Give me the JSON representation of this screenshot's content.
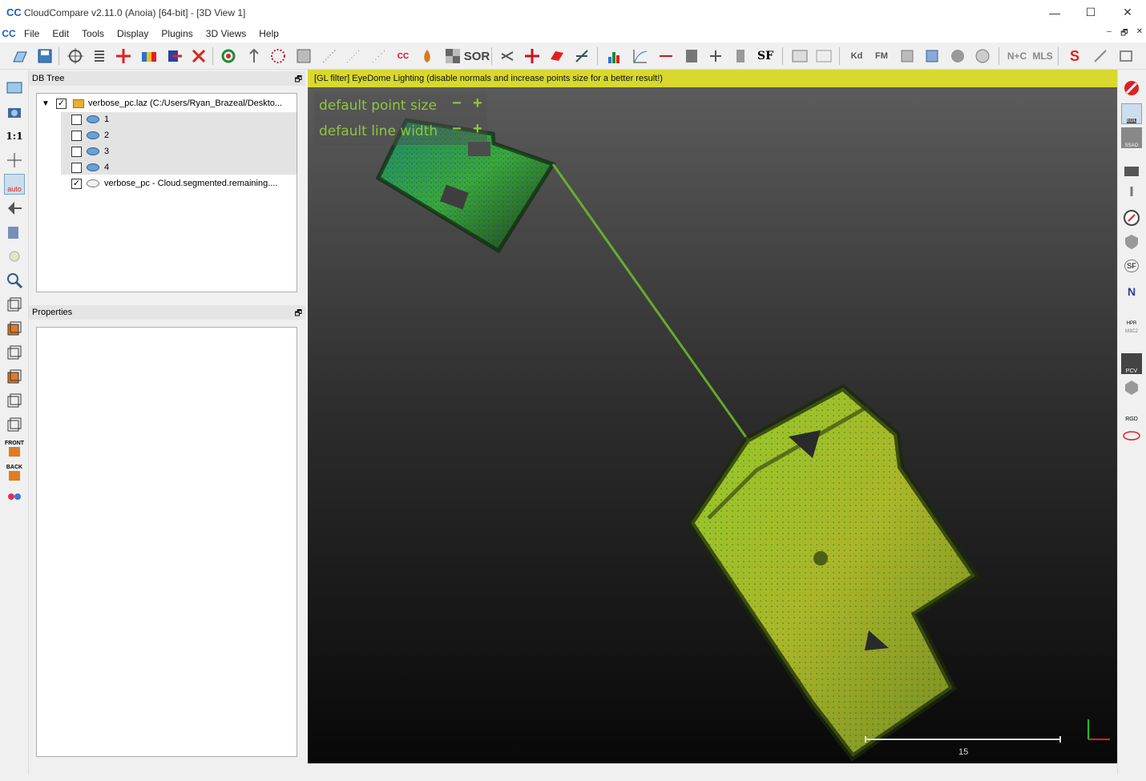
{
  "window": {
    "title": "CloudCompare v2.11.0 (Anoia) [64-bit] - [3D View 1]",
    "app_icon": "CC"
  },
  "window_controls": {
    "minimize": "—",
    "maximize": "☐",
    "close": "✕",
    "mdi_minimize": "–",
    "mdi_restore": "🗗",
    "mdi_close": "✕"
  },
  "menu": {
    "items": [
      "File",
      "Edit",
      "Tools",
      "Display",
      "Plugins",
      "3D Views",
      "Help"
    ]
  },
  "toolbar": {
    "icons": [
      "open-icon",
      "save-icon",
      "global-shift-icon",
      "list-icon",
      "add-point-icon",
      "color-ramp-icon",
      "sample-icon",
      "delete-icon",
      "register-icon",
      "pick-icon",
      "dots-icon",
      "mesh-icon",
      "subsample-icon",
      "scatter-icon",
      "project-icon",
      "cc-icon",
      "fire-icon",
      "checker-icon",
      "sor-icon",
      "scissors-icon",
      "translate-icon",
      "plane-icon",
      "axis-icon",
      "histogram-icon",
      "curve-icon",
      "minmax-icon",
      "calculator-icon",
      "plus-icon",
      "column-icon",
      "sf-icon",
      "canupo-create-icon",
      "canupo-classify-icon",
      "kd-icon",
      "fm-icon",
      "pdf-icon",
      "csv-icon",
      "sphere-icon",
      "globe-icon",
      "n-c-icon",
      "mls-icon",
      "s-icon",
      "tools-icon",
      "export-icon"
    ],
    "labels": {
      "cc": "CC",
      "sor": "SOR",
      "sf": "SF",
      "kd": "Kd",
      "fm": "FM",
      "n_c": "N+C",
      "mls": "MLS"
    }
  },
  "left_toolbar": {
    "ratio_label": "1:1",
    "auto_label": "auto",
    "front_label": "FRONT",
    "back_label": "BACK"
  },
  "right_toolbar": {
    "edl_label": "EDL",
    "ssao_label": "SSAO",
    "sf_label": "SF",
    "n_label": "N",
    "hpr_label": "HPR",
    "m3c2_label": "M3C2",
    "pcv_label": "PCV",
    "rgd_label": "RGD"
  },
  "db_tree": {
    "header": "DB Tree",
    "root": {
      "label": "verbose_pc.laz (C:/Users/Ryan_Brazeal/Deskto...",
      "checked": true
    },
    "children": [
      {
        "label": "1",
        "checked": false
      },
      {
        "label": "2",
        "checked": false
      },
      {
        "label": "3",
        "checked": false
      },
      {
        "label": "4",
        "checked": false
      },
      {
        "label": "verbose_pc - Cloud.segmented.remaining....",
        "checked": true
      }
    ]
  },
  "properties": {
    "header": "Properties"
  },
  "view3d": {
    "gl_banner": "[GL filter] EyeDome Lighting (disable normals and increase points size for a better result!)",
    "point_size_label": "default point size",
    "line_width_label": "default line width",
    "minus": "−",
    "plus": "+",
    "scale_value": "15",
    "colors": {
      "banner": "#d8d82e",
      "overlay_text": "#8ec63f",
      "axis_x": "#e02020",
      "axis_y": "#20c020"
    }
  }
}
